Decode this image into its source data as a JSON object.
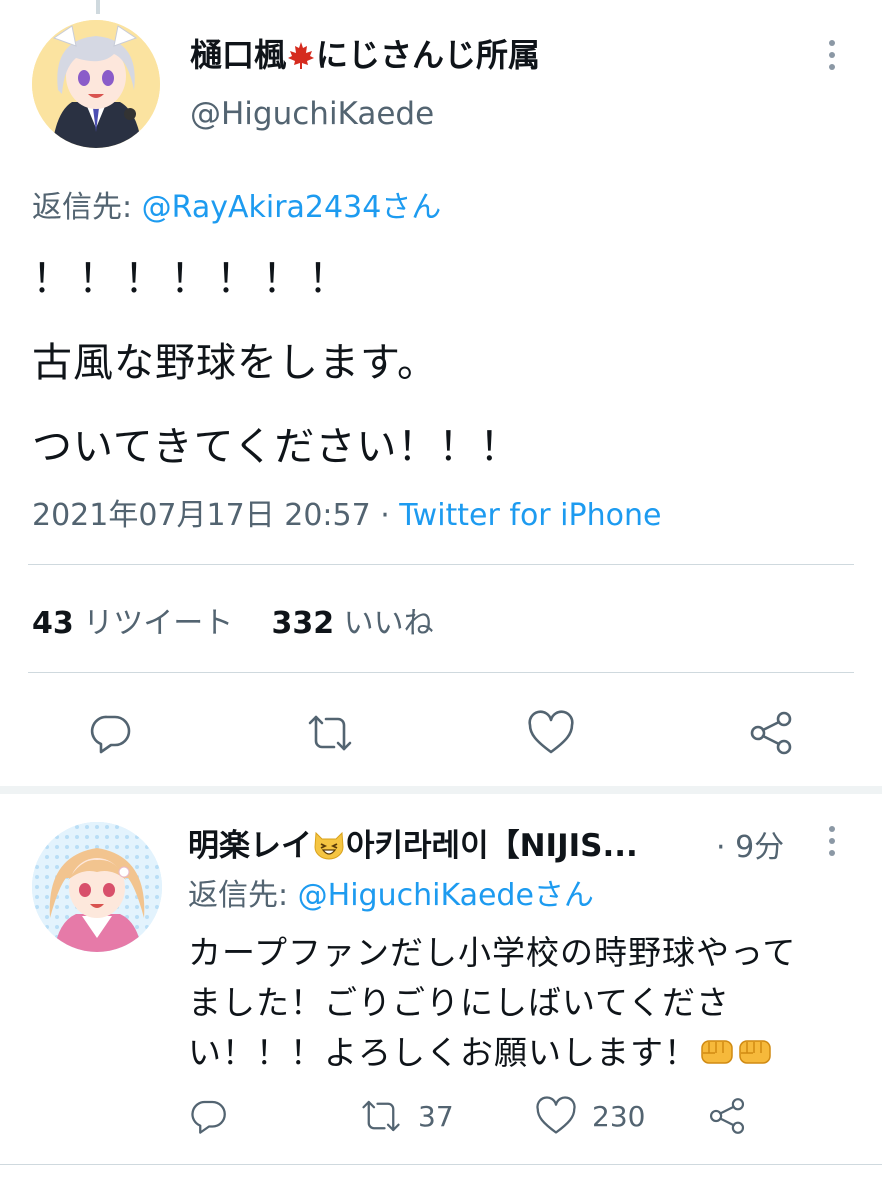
{
  "main_tweet": {
    "author_name_pre": "樋口楓",
    "author_name_post": "にじさんじ所属",
    "flag_icon": "maple-leaf",
    "handle": "@HiguchiKaede",
    "reply_to_label": "返信先: ",
    "reply_to_user": "@RayAkira2434さん",
    "text_lines": [
      "！！！！！！！",
      "古風な野球をします。",
      "ついてきてください！！！"
    ],
    "timestamp": "2021年07月17日 20:57",
    "separator": " · ",
    "source": "Twitter for iPhone",
    "retweet_count": "43",
    "retweet_label": "リツイート",
    "like_count": "332",
    "like_label": "いいね"
  },
  "reply_tweet": {
    "author_name_pre": "明楽レイ",
    "author_name_emoji": "😆",
    "author_name_post": "아키라레이【NIJIS...",
    "time": "· 9分",
    "reply_to_label": "返信先: ",
    "reply_to_user": "@HiguchiKaedeさん",
    "text_lines": [
      "カープファンだし小学校の時野球やって",
      "ました！ごりごりにしばいてくださ",
      "い！！！よろしくお願いします！"
    ],
    "retweet_count": "37",
    "like_count": "230"
  },
  "colors": {
    "accent": "#1d9bf0",
    "muted": "#536471",
    "text": "#0f1419",
    "divider": "#cfd9de"
  }
}
